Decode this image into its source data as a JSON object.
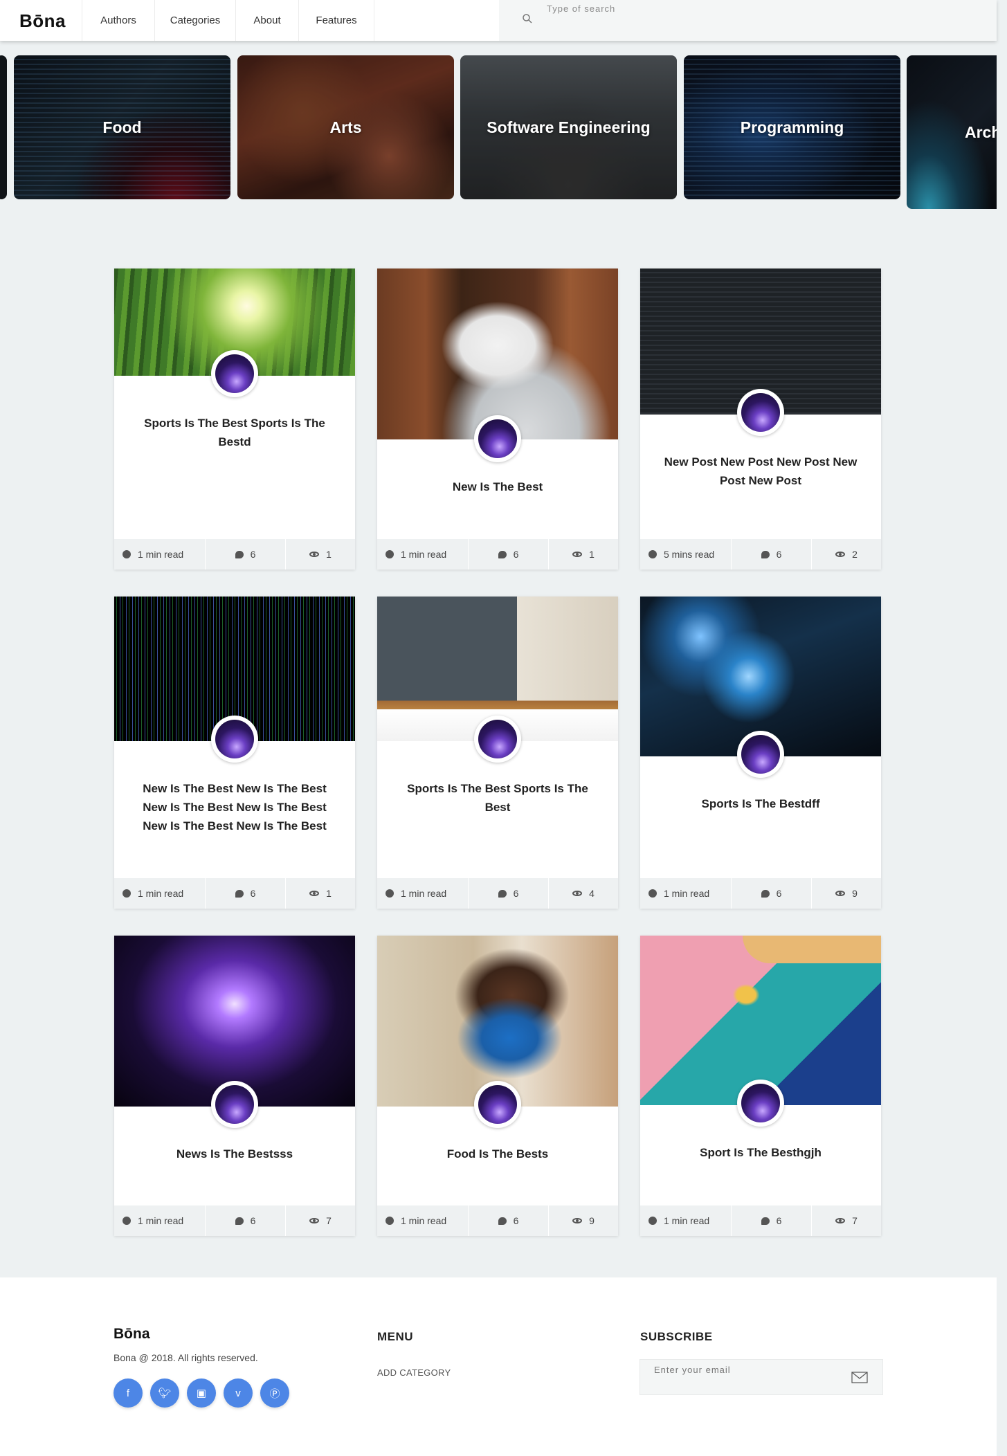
{
  "header": {
    "logo": "Bōna",
    "nav": [
      "Authors",
      "Categories",
      "About",
      "Features"
    ],
    "search_placeholder": "Type of search"
  },
  "categories": [
    "Food",
    "Arts",
    "Software Engineering",
    "Programming",
    "Arch"
  ],
  "posts": [
    {
      "title": "Sports Is The Best Sports Is The Bestd",
      "read": "1 min read",
      "comments": "6",
      "views": "1"
    },
    {
      "title": "New Is The Best",
      "read": "1 min read",
      "comments": "6",
      "views": "1"
    },
    {
      "title": "New Post New Post New Post New Post New Post",
      "read": "5 mins read",
      "comments": "6",
      "views": "2"
    },
    {
      "title": "New Is The Best New Is The Best New Is The Best New Is The Best New Is The Best New Is The Best",
      "read": "1 min read",
      "comments": "6",
      "views": "1"
    },
    {
      "title": "Sports Is The Best Sports Is The Best",
      "read": "1 min read",
      "comments": "6",
      "views": "4"
    },
    {
      "title": "Sports Is The Bestdff",
      "read": "1 min read",
      "comments": "6",
      "views": "9"
    },
    {
      "title": "News Is The Bestsss",
      "read": "1 min read",
      "comments": "6",
      "views": "7"
    },
    {
      "title": "Food Is The Bests",
      "read": "1 min read",
      "comments": "6",
      "views": "9"
    },
    {
      "title": "Sport Is The Besthgjh",
      "read": "1 min read",
      "comments": "6",
      "views": "7"
    }
  ],
  "footer": {
    "logo": "Bōna",
    "copyright": "Bona @ 2018. All rights reserved.",
    "menu_heading": "MENU",
    "menu_link": "ADD CATEGORY",
    "subscribe_heading": "SUBSCRIBE",
    "email_placeholder": "Enter your email",
    "social_icons": [
      "facebook-icon",
      "twitter-icon",
      "instagram-icon",
      "vimeo-icon",
      "pinterest-icon"
    ]
  },
  "colors": {
    "accent": "#4d86e6",
    "page_bg": "#edf1f2"
  }
}
